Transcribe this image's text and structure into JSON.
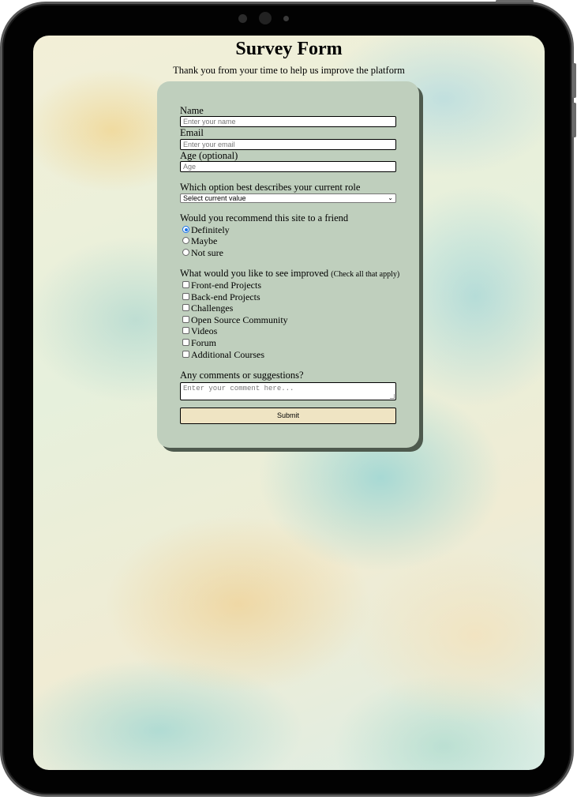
{
  "page": {
    "title": "Survey Form",
    "subtitle": "Thank you from your time to help us improve the platform"
  },
  "form": {
    "name": {
      "label": "Name",
      "placeholder": "Enter your name"
    },
    "email": {
      "label": "Email",
      "placeholder": "Enter your email"
    },
    "age": {
      "label": "Age (optional)",
      "placeholder": "Age"
    },
    "role": {
      "label": "Which option best describes your current role",
      "selected": "Select current value"
    },
    "recommend": {
      "label": "Would you recommend this site to a friend",
      "options": [
        "Definitely",
        "Maybe",
        "Not sure"
      ],
      "selected": "Definitely"
    },
    "improve": {
      "label": "What would you like to see improved",
      "hint": "(Check all that apply)",
      "options": [
        "Front-end Projects",
        "Back-end Projects",
        "Challenges",
        "Open Source Community",
        "Videos",
        "Forum",
        "Additional Courses"
      ]
    },
    "comments": {
      "label": "Any comments or suggestions?",
      "placeholder": "Enter your comment here..."
    },
    "submit_label": "Submit"
  },
  "colors": {
    "card": "#bfcfbd",
    "card_shadow": "#4e5a4e",
    "submit": "#efe4c3",
    "radio_accent": "#1a73e8"
  }
}
